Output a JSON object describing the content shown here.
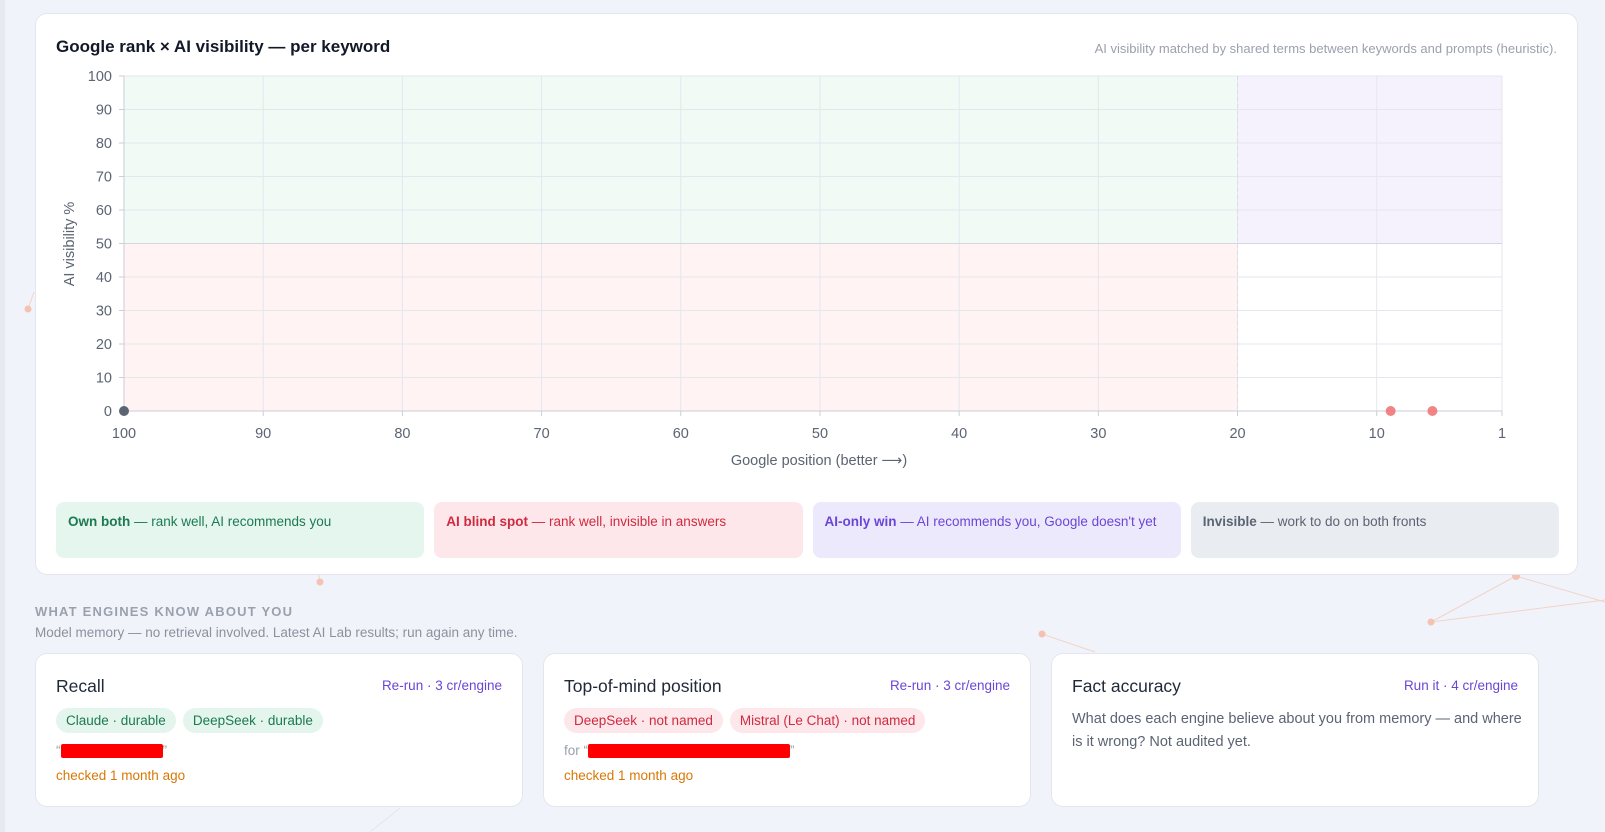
{
  "chart_card": {
    "title": "Google rank × AI visibility — per keyword",
    "note": "AI visibility matched by shared terms between keywords and prompts (heuristic).",
    "legend": [
      {
        "key": "green",
        "bold": "Own both",
        "text": " — rank well, AI recommends you"
      },
      {
        "key": "red",
        "bold": "AI blind spot",
        "text": " — rank well, invisible in answers"
      },
      {
        "key": "purple",
        "bold": "AI-only win",
        "text": " — AI recommends you, Google doesn't yet"
      },
      {
        "key": "gray",
        "bold": "Invisible",
        "text": " — work to do on both fronts"
      }
    ]
  },
  "chart_data": {
    "type": "scatter",
    "xlabel": "Google position (better ⟶)",
    "ylabel": "AI visibility %",
    "x_ticks": [
      100,
      90,
      80,
      70,
      60,
      50,
      40,
      30,
      20,
      10,
      1
    ],
    "y_ticks": [
      0,
      10,
      20,
      30,
      40,
      50,
      60,
      70,
      80,
      90,
      100
    ],
    "xlim": [
      100,
      1
    ],
    "ylim": [
      0,
      100
    ],
    "grid": true,
    "quadrant_thresholds": {
      "x": 20,
      "y": 50
    },
    "colors": {
      "quadrant_top_left": "#f2faf6",
      "quadrant_bottom_left": "#fff3f4",
      "quadrant_top_right": "#f5f2fe",
      "quadrant_bottom_right": "#ffffff",
      "point_unranked": "#4b5563",
      "point_ranked": "#f07878"
    },
    "points": [
      {
        "x": 100,
        "y": 0,
        "group": "unranked"
      },
      {
        "x": 9,
        "y": 0,
        "group": "ranked"
      },
      {
        "x": 6,
        "y": 0,
        "group": "ranked"
      }
    ]
  },
  "memory_section": {
    "heading": "WHAT ENGINES KNOW ABOUT YOU",
    "subheading": "Model memory — no retrieval involved. Latest AI Lab results; run again any time.",
    "cards": {
      "recall": {
        "title": "Recall",
        "action": "Re-run · 3 cr/engine",
        "chips": [
          "Claude · durable",
          "DeepSeek · durable"
        ],
        "query_prefix": "",
        "quote_open": "“",
        "quote_close": "”",
        "checked": "checked 1 month ago"
      },
      "top_of_mind": {
        "title": "Top-of-mind position",
        "action": "Re-run · 3 cr/engine",
        "chips": [
          "DeepSeek · not named",
          "Mistral (Le Chat) · not named"
        ],
        "query_prefix": "for ",
        "quote_open": "“",
        "quote_close": "”",
        "checked": "checked 1 month ago"
      },
      "fact_accuracy": {
        "title": "Fact accuracy",
        "action": "Run it · 4 cr/engine",
        "description": "What does each engine believe about you from memory — and where is it wrong? Not audited yet."
      }
    }
  }
}
